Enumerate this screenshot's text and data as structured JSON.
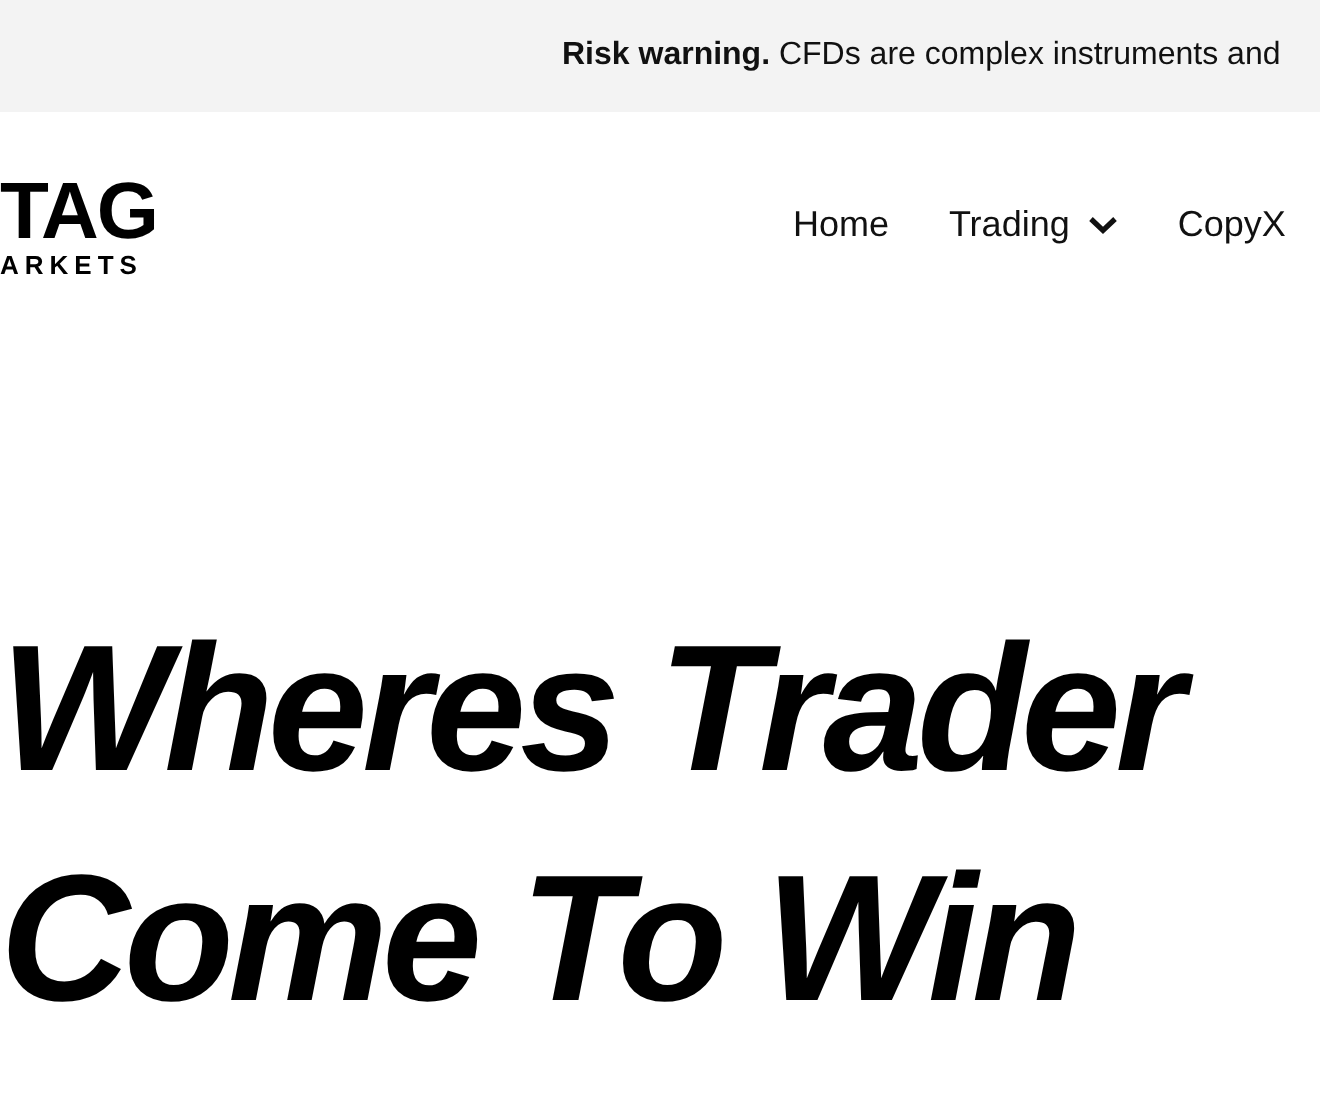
{
  "risk_banner": {
    "text": "**Risk warning.** CFDs are complex instruments and"
  },
  "logo": {
    "top": "TAG",
    "bottom": "ARKETS"
  },
  "nav": [
    {
      "label": "Home",
      "has_menu": false
    },
    {
      "label": "Trading",
      "has_menu": true
    },
    {
      "label": "CopyX",
      "has_menu": false
    }
  ],
  "hero": {
    "lines": [
      "Wheres Trader",
      "Come To Win"
    ]
  }
}
